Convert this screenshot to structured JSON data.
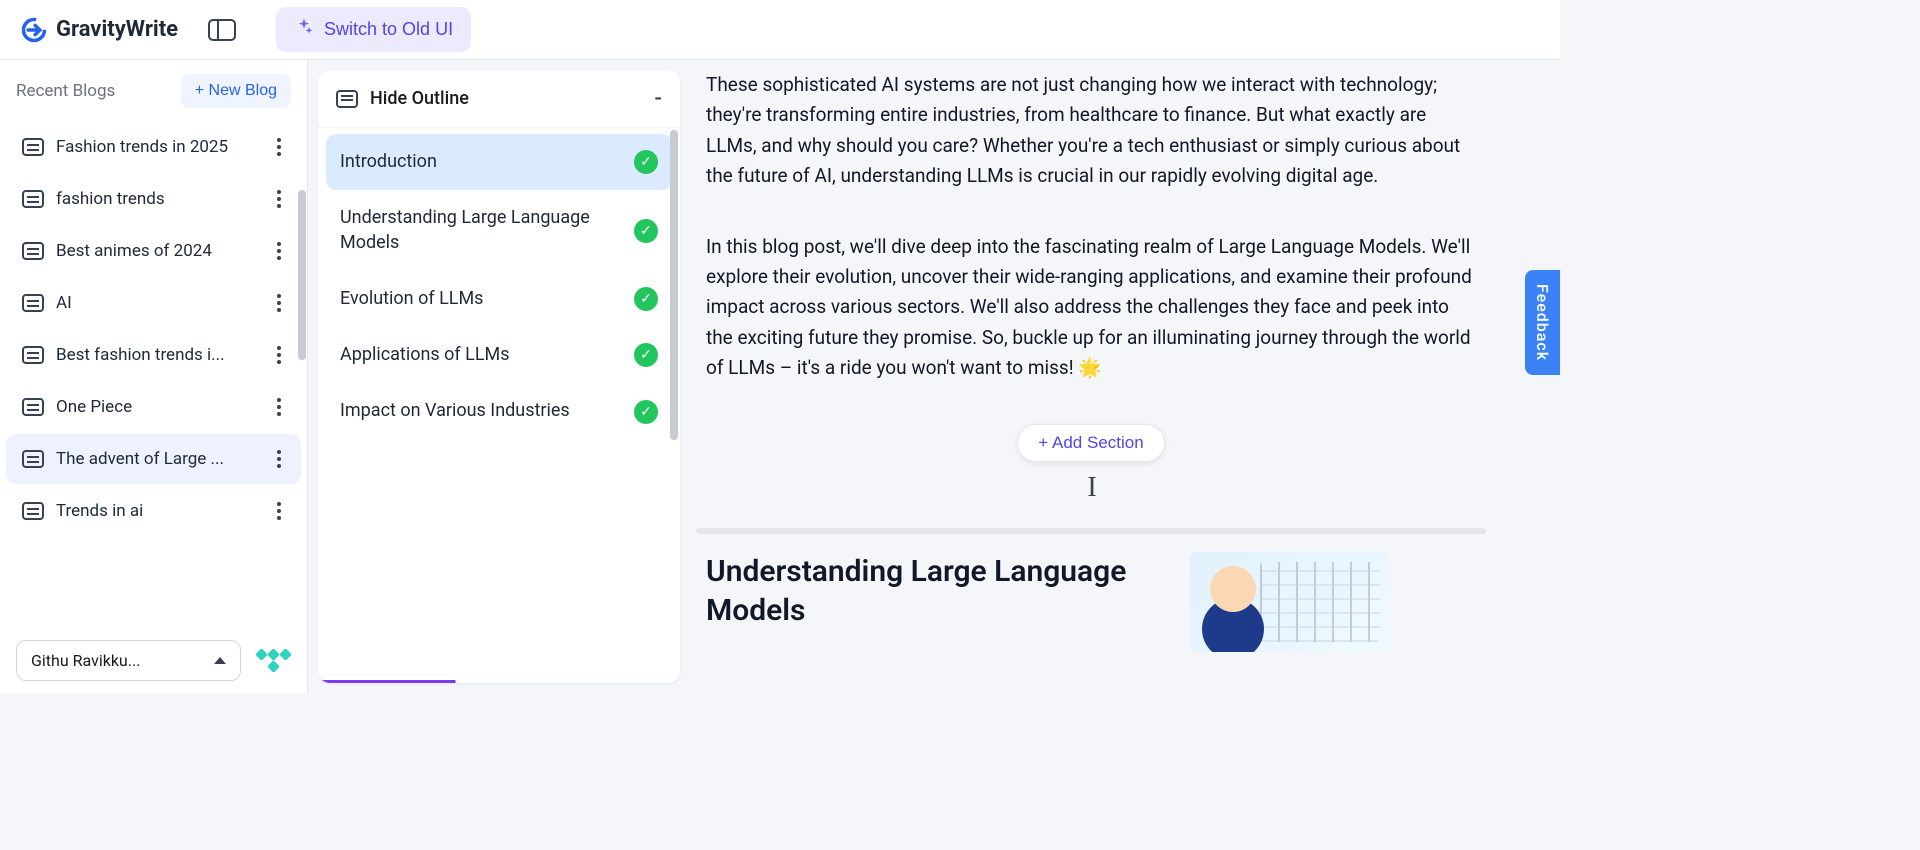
{
  "header": {
    "brand": "GravityWrite",
    "switch_btn": "Switch to Old UI"
  },
  "sidebar": {
    "recent_label": "Recent Blogs",
    "new_blog_btn": "+ New Blog",
    "blogs": [
      {
        "title": "Fashion trends in 2025",
        "active": false
      },
      {
        "title": "fashion trends",
        "active": false
      },
      {
        "title": "Best animes of 2024",
        "active": false
      },
      {
        "title": "AI",
        "active": false
      },
      {
        "title": "Best fashion trends i...",
        "active": false
      },
      {
        "title": "One Piece",
        "active": false
      },
      {
        "title": "The advent of Large ...",
        "active": true
      },
      {
        "title": "Trends in ai",
        "active": false
      }
    ],
    "user_name": "Githu Ravikku..."
  },
  "outline": {
    "header_label": "Hide Outline",
    "collapse_symbol": "-",
    "items": [
      {
        "label": "Introduction",
        "done": true,
        "active": true
      },
      {
        "label": "Understanding Large Language Models",
        "done": true,
        "active": false
      },
      {
        "label": "Evolution of LLMs",
        "done": true,
        "active": false
      },
      {
        "label": "Applications of LLMs",
        "done": true,
        "active": false
      },
      {
        "label": "Impact on Various Industries",
        "done": true,
        "active": false
      }
    ]
  },
  "editor": {
    "para1": "These sophisticated AI systems are not just changing how we interact with technology; they're transforming entire industries, from healthcare to finance. But what exactly are LLMs, and why should you care? Whether you're a tech enthusiast or simply curious about the future of AI, understanding LLMs is crucial in our rapidly evolving digital age.",
    "para2": "In this blog post, we'll dive deep into the fascinating realm of Large Language Models. We'll explore their evolution, uncover their wide-ranging applications, and examine their profound impact across various sectors. We'll also address the challenges they face and peek into the exciting future they promise. So, buckle up for an illuminating journey through the world of LLMs – it's a ride you won't want to miss! 🌟",
    "add_section_btn": "+ Add Section",
    "next_heading": "Understanding Large Language Models"
  },
  "feedback_label": "Feedback"
}
